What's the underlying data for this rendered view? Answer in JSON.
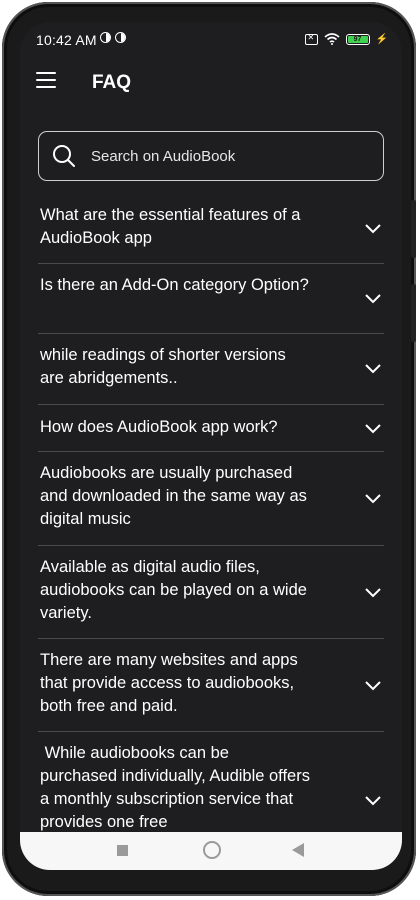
{
  "status": {
    "time": "10:42 AM",
    "battery_level": "97",
    "battery_color": "#3fd14f"
  },
  "appbar": {
    "title": "FAQ",
    "menu_icon": "hamburger-icon"
  },
  "search": {
    "placeholder": "Search on AudioBook",
    "value": ""
  },
  "faq": {
    "items": [
      {
        "question": "What are the essential features of a AudioBook app"
      },
      {
        "question": "Is there an Add-On category Option?"
      },
      {
        "question": "while readings of shorter versions are abridgements.."
      },
      {
        "question": "How does AudioBook app work?"
      },
      {
        "question": "Audiobooks are usually purchased and downloaded in the same way as digital music"
      },
      {
        "question": "Available as digital audio files, audiobooks can be played on a wide variety."
      },
      {
        "question": "There are many websites and apps that provide access to audiobooks, both free and paid."
      },
      {
        "question": " While audiobooks can be purchased individually, Audible offers a monthly subscription service that provides one free"
      }
    ]
  },
  "theme": {
    "background": "#1e1e20",
    "text": "#ffffff",
    "divider": "#4a4a4a"
  }
}
